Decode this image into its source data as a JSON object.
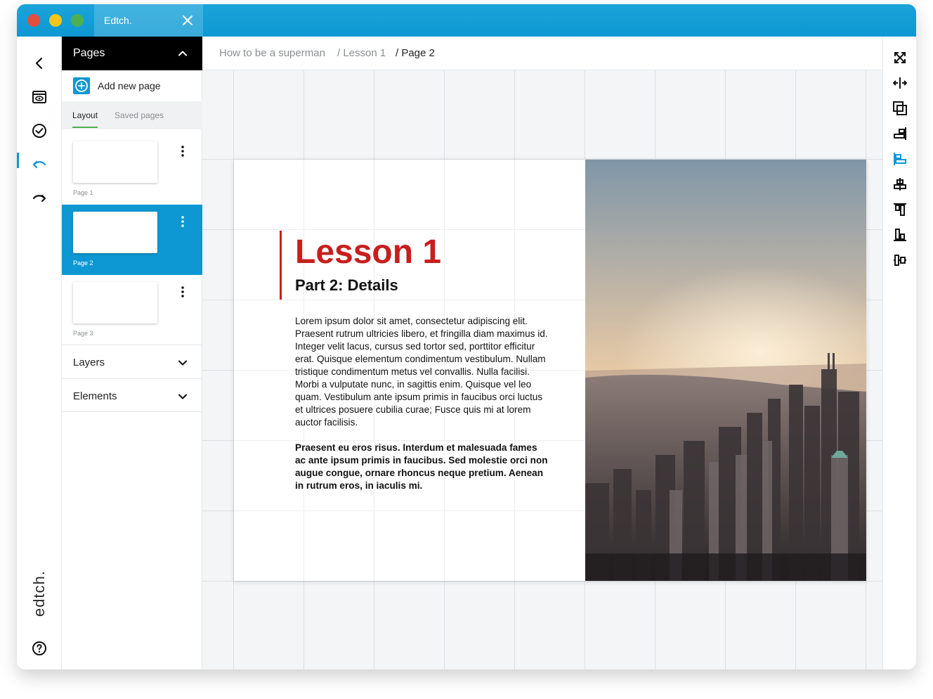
{
  "window": {
    "tab_title": "Edtch.",
    "brand": "edtch."
  },
  "rail": {
    "icons": [
      "back-icon",
      "preview-icon",
      "check-icon",
      "undo-icon",
      "redo-icon",
      "help-icon"
    ]
  },
  "pages_panel": {
    "title": "Pages",
    "add_label": "Add new page",
    "tabs": [
      "Layout",
      "Saved pages"
    ],
    "pages": [
      {
        "caption": "Page 1",
        "selected": false
      },
      {
        "caption": "Page 2",
        "selected": true
      },
      {
        "caption": "Page 3",
        "selected": false
      }
    ],
    "sections": [
      "Layers",
      "Elements"
    ]
  },
  "breadcrumb": {
    "items": [
      "How to be a superman",
      "/ Lesson 1",
      "/ Page 2"
    ]
  },
  "document": {
    "title": "Lesson 1",
    "subtitle": "Part 2: Details",
    "body": "Lorem ipsum dolor sit amet, consectetur adipiscing elit. Praesent rutrum ultricies libero, et fringilla diam maximus id. Integer velit lacus, cursus sed tortor sed, porttitor efficitur erat. Quisque elementum condimentum vestibulum. Nullam tristique condimentum metus vel convallis. Nulla facilisi. Morbi a vulputate nunc, in sagittis enim. Quisque vel leo quam. Vestibulum ante ipsum primis in faucibus orci luctus et ultrices posuere cubilia curae; Fusce quis mi at lorem auctor facilisis.",
    "body_bold": "Praesent eu eros risus. Interdum et malesuada fames ac ante ipsum primis in faucibus. Sed molestie orci non augue congue, ornare rhoncus neque pretium. Aenean in rutrum eros, in iaculis mi.",
    "image": "city-skyline-photo"
  },
  "toolbar": {
    "icons": [
      "fullscreen-icon",
      "flip-horizontal-icon",
      "arrange-icon",
      "align-right-icon",
      "align-left-icon",
      "align-center-icon",
      "align-top-icon",
      "align-bottom-icon",
      "distribute-icon"
    ]
  },
  "colors": {
    "accent": "#0e98d3",
    "title_red": "#c81e1e",
    "tab_underline": "#4caf50"
  }
}
